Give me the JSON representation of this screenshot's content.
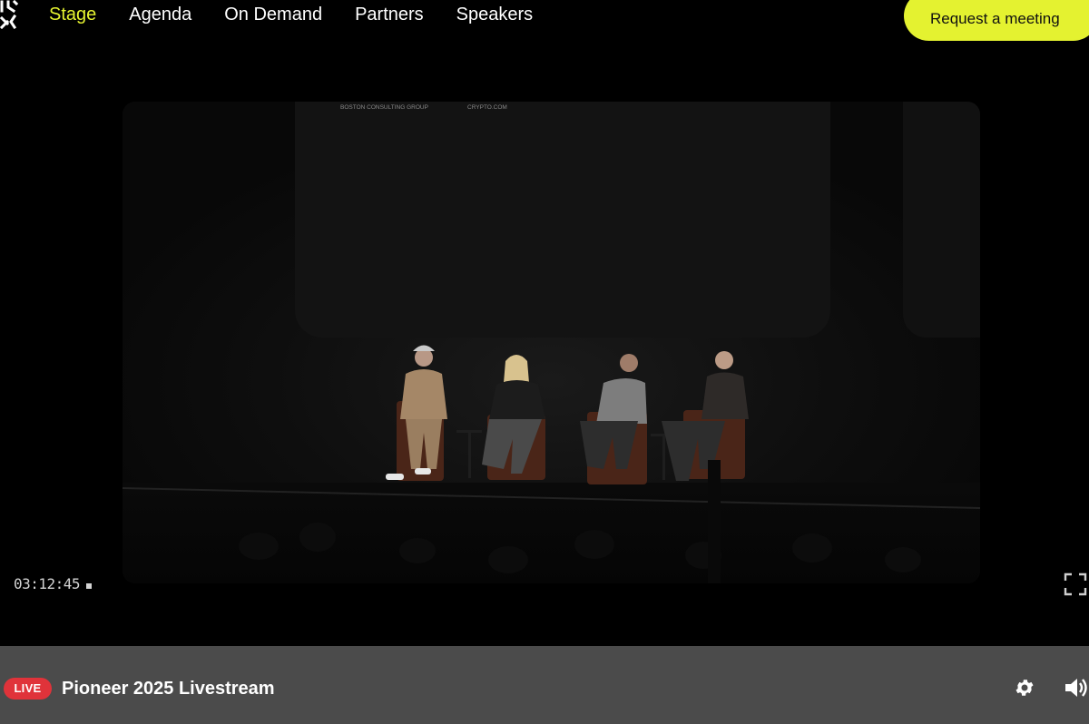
{
  "nav": {
    "logo_icon": "brand-logo-icon",
    "items": [
      {
        "label": "Stage",
        "active": true
      },
      {
        "label": "Agenda",
        "active": false
      },
      {
        "label": "On Demand",
        "active": false
      },
      {
        "label": "Partners",
        "active": false
      },
      {
        "label": "Speakers",
        "active": false
      }
    ],
    "cta_label": "Request a meeting"
  },
  "video": {
    "screen_labels": [
      "BOSTON CONSULTING GROUP",
      "CRYPTO.COM"
    ],
    "timecode": "03:12:45",
    "fullscreen_icon": "fullscreen-icon"
  },
  "player": {
    "live_label": "LIVE",
    "title": "Pioneer 2025 Livestream",
    "settings_icon": "gear-icon",
    "volume_icon": "speaker-volume-icon"
  },
  "colors": {
    "accent": "#e4f230",
    "live": "#e0333a",
    "bar": "#4b4b4b",
    "background": "#000000"
  }
}
